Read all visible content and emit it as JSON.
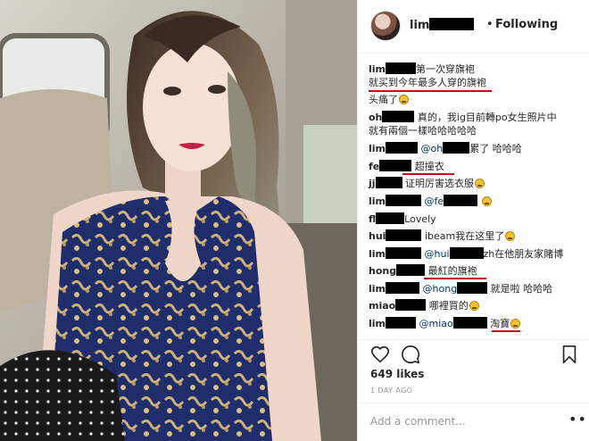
{
  "header": {
    "username_prefix": "lim",
    "separator": "•",
    "follow_status": "Following"
  },
  "comments": [
    {
      "user": "lim",
      "text": "第一次穿旗袍"
    },
    {
      "user": "",
      "text": "就买到今年最多人穿的旗袍"
    },
    {
      "user": "",
      "text": "头痛了"
    },
    {
      "user": "oh",
      "text": "真的，我ig目前轉po女生照片中"
    },
    {
      "user": "",
      "text": "就有兩個一樣哈哈哈哈哈"
    },
    {
      "user": "lim",
      "mention": "@oh",
      "text": "累了 哈哈哈"
    },
    {
      "user": "fe",
      "text": "超撞衣"
    },
    {
      "user": "jj",
      "text": "证明厉害选衣服"
    },
    {
      "user": "lim",
      "mention": "@fe",
      "text": ""
    },
    {
      "user": "fl",
      "text": "Lovely"
    },
    {
      "user": "hui",
      "text": "ibeam我在这里了"
    },
    {
      "user": "lim",
      "mention": "@hui",
      "text": "zh在他朋友家賭博"
    },
    {
      "user": "hong",
      "text": "最紅的旗袍"
    },
    {
      "user": "lim",
      "mention": "@hong",
      "text": "就是啦 哈哈哈"
    },
    {
      "user": "miao",
      "text": "哪裡買的"
    },
    {
      "user": "lim",
      "mention": "@miao",
      "text": "淘寶"
    }
  ],
  "actions": {
    "icons": [
      "heart-icon",
      "comment-icon",
      "bookmark-icon"
    ]
  },
  "likes": "649 likes",
  "timestamp": "1 DAY AGO",
  "add_comment_placeholder": "Add a comment...",
  "more_options": "•••",
  "colors": {
    "highlight": "#d0021b",
    "mention": "#003569",
    "muted": "#999999"
  }
}
